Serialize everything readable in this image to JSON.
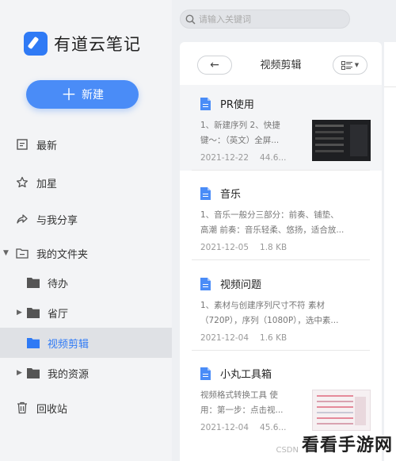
{
  "app": {
    "name": "有道云笔记",
    "brand_color": "#2f7af5"
  },
  "sidebar": {
    "new_button": "新建",
    "items": [
      {
        "label": "最新",
        "icon": "recent-icon"
      },
      {
        "label": "加星",
        "icon": "star-icon"
      },
      {
        "label": "与我分享",
        "icon": "share-icon"
      },
      {
        "label": "我的文件夹",
        "icon": "folder-outline-icon",
        "expanded": true
      },
      {
        "label": "待办",
        "icon": "folder-icon"
      },
      {
        "label": "省厅",
        "icon": "folder-icon",
        "collapsed": true
      },
      {
        "label": "视频剪辑",
        "icon": "folder-icon",
        "active": true
      },
      {
        "label": "我的资源",
        "icon": "folder-icon",
        "collapsed": true
      },
      {
        "label": "回收站",
        "icon": "trash-icon"
      }
    ]
  },
  "search": {
    "placeholder": "请输入关键词"
  },
  "list": {
    "title": "视频剪辑",
    "notes": [
      {
        "title": "PR使用",
        "snippet_1": "1、新建序列 2、快捷",
        "snippet_2": "键～：（英文）全屏...",
        "date": "2021-12-22",
        "size": "44.6...",
        "selected": true
      },
      {
        "title": "音乐",
        "snippet_1": "1、音乐一般分三部分：前奏、铺垫、",
        "snippet_2": "高潮 前奏：音乐轻柔、悠扬，适合放...",
        "date": "2021-12-05",
        "size": "1.8 KB"
      },
      {
        "title": "视频问题",
        "snippet_1": "1、素材与创建序列尺寸不符 素材",
        "snippet_2": "（720P），序列（1080P），选中素...",
        "date": "2021-12-04",
        "size": "1.6 KB"
      },
      {
        "title": "小丸工具箱",
        "snippet_1": "视频格式转换工具 使",
        "snippet_2": "用：第一步：点击视...",
        "date": "2021-12-04",
        "size": "45.6..."
      }
    ]
  },
  "watermark": {
    "csdn": "CSDN",
    "text": "看看手游网"
  }
}
